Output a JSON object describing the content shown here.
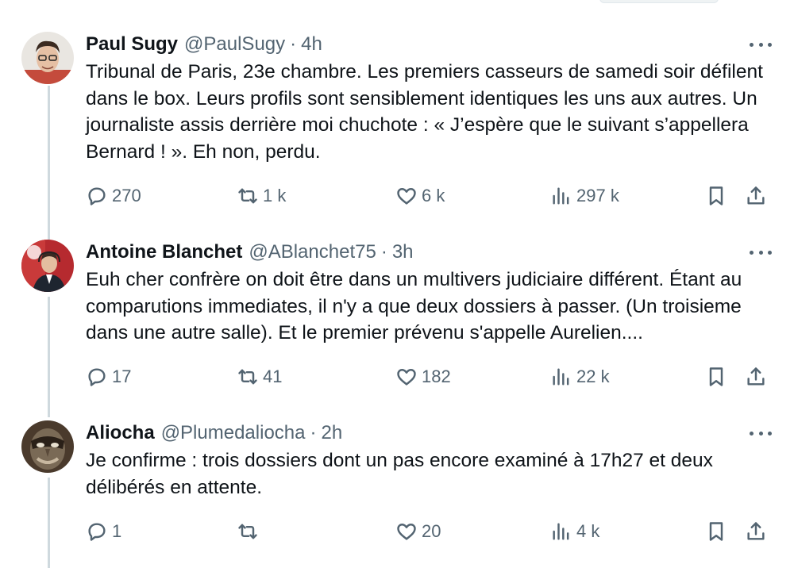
{
  "tweets": [
    {
      "name": "Paul Sugy",
      "handle": "@PaulSugy",
      "time": "4h",
      "text": "Tribunal de Paris, 23e chambre. Les premiers casseurs de samedi soir défilent dans le box. Leurs profils sont sensiblement identiques les uns aux autres. Un journaliste assis derrière moi chuchote : « J’espère que le suivant s’appellera Bernard ! ». Eh non, perdu.",
      "replies": "270",
      "retweets": "1 k",
      "likes": "6 k",
      "views": "297 k"
    },
    {
      "name": "Antoine Blanchet",
      "handle": "@ABlanchet75",
      "time": "3h",
      "text": "Euh cher confrère on doit être dans un multivers judiciaire différent. Étant au comparutions immediates, il n'y a que deux dossiers à passer. (Un troisieme dans une autre salle). Et le premier prévenu s'appelle Aurelien....",
      "replies": "17",
      "retweets": "41",
      "likes": "182",
      "views": "22 k"
    },
    {
      "name": "Aliocha",
      "handle": "@Plumedaliocha",
      "time": "2h",
      "text": "Je confirme : trois dossiers dont un pas encore examiné à 17h27 et deux délibérés en attente.",
      "replies": "1",
      "retweets": "",
      "likes": "20",
      "views": "4 k"
    }
  ],
  "separator": "·",
  "icons": [
    "more-icon",
    "reply-icon",
    "retweet-icon",
    "like-icon",
    "views-icon",
    "bookmark-icon",
    "share-icon"
  ],
  "colors": {
    "text": "#0f1419",
    "secondary": "#536471",
    "thread_line": "#cfd9de"
  }
}
